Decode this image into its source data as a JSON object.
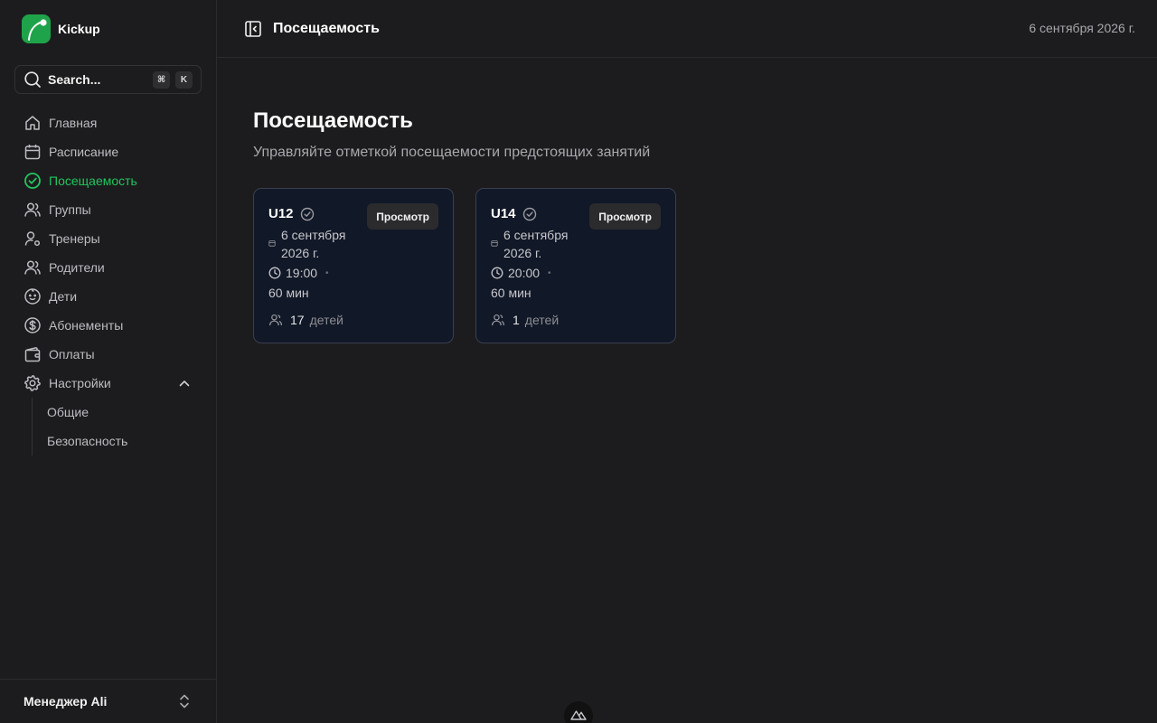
{
  "app": {
    "name": "Kickup"
  },
  "search": {
    "label": "Search...",
    "kbd_cmd": "⌘",
    "kbd_key": "K"
  },
  "sidebar": {
    "items": [
      {
        "label": "Главная",
        "icon": "home-icon"
      },
      {
        "label": "Расписание",
        "icon": "calendar-icon"
      },
      {
        "label": "Посещаемость",
        "icon": "check-circle-icon",
        "active": true
      },
      {
        "label": "Группы",
        "icon": "users-icon"
      },
      {
        "label": "Тренеры",
        "icon": "user-cog-icon"
      },
      {
        "label": "Родители",
        "icon": "users-icon"
      },
      {
        "label": "Дети",
        "icon": "baby-icon"
      },
      {
        "label": "Абонементы",
        "icon": "dollar-circle-icon"
      },
      {
        "label": "Оплаты",
        "icon": "wallet-icon"
      },
      {
        "label": "Настройки",
        "icon": "gear-icon",
        "expanded": true
      }
    ],
    "settings_children": [
      {
        "label": "Общие"
      },
      {
        "label": "Безопасность"
      }
    ]
  },
  "user": {
    "name": "Менеджер Ali"
  },
  "header": {
    "title": "Посещаемость",
    "date": "6 сентября 2026 г."
  },
  "main": {
    "title": "Посещаемость",
    "subtitle": "Управляйте отметкой посещаемости предстоящих занятий",
    "cards": [
      {
        "group": "U12",
        "view_label": "Просмотр",
        "date": "6 сентября 2026 г.",
        "time": "19:00",
        "duration": "60 мин",
        "kids_count": "17",
        "kids_label": "детей"
      },
      {
        "group": "U14",
        "view_label": "Просмотр",
        "date": "6 сентября 2026 г.",
        "time": "20:00",
        "duration": "60 мин",
        "kids_count": "1",
        "kids_label": "детей"
      }
    ]
  },
  "colors": {
    "background": "#1c1c1e",
    "accent": "#22c55e",
    "card_bg": "#111827",
    "brand": "#1fa34a"
  }
}
